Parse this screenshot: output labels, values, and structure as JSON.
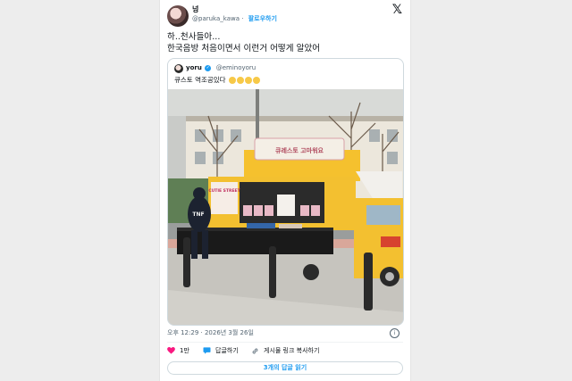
{
  "tweet": {
    "author_name": "넝",
    "author_handle": "@paruka_kawa",
    "follow_label": "팔로우하기",
    "text_line1": "하..천사들아...",
    "text_line2": "한국음방 처음이면서 이런거 어떻게 알았어",
    "timestamp": "오후 12:29 · 2026년 3월 26일"
  },
  "quote": {
    "author_name": "yoru",
    "author_handle": "@eminoyoru",
    "text": "큐스토 역조공있다",
    "photo_banner": "큐레스토 고마워요",
    "photo_side_logo": "CUTIE STREET"
  },
  "actions": {
    "like_count": "1만",
    "reply_label": "답글하기",
    "copy_link_label": "게시물 링크 복사하기"
  },
  "replies_button_label": "3개의 답글 읽기",
  "colors": {
    "accent": "#1d9bf0",
    "like": "#f91880",
    "truck": "#f5c12e"
  },
  "icons": [
    "x-logo-icon",
    "verified-icon",
    "heart-icon",
    "reply-icon",
    "link-icon",
    "info-icon"
  ]
}
